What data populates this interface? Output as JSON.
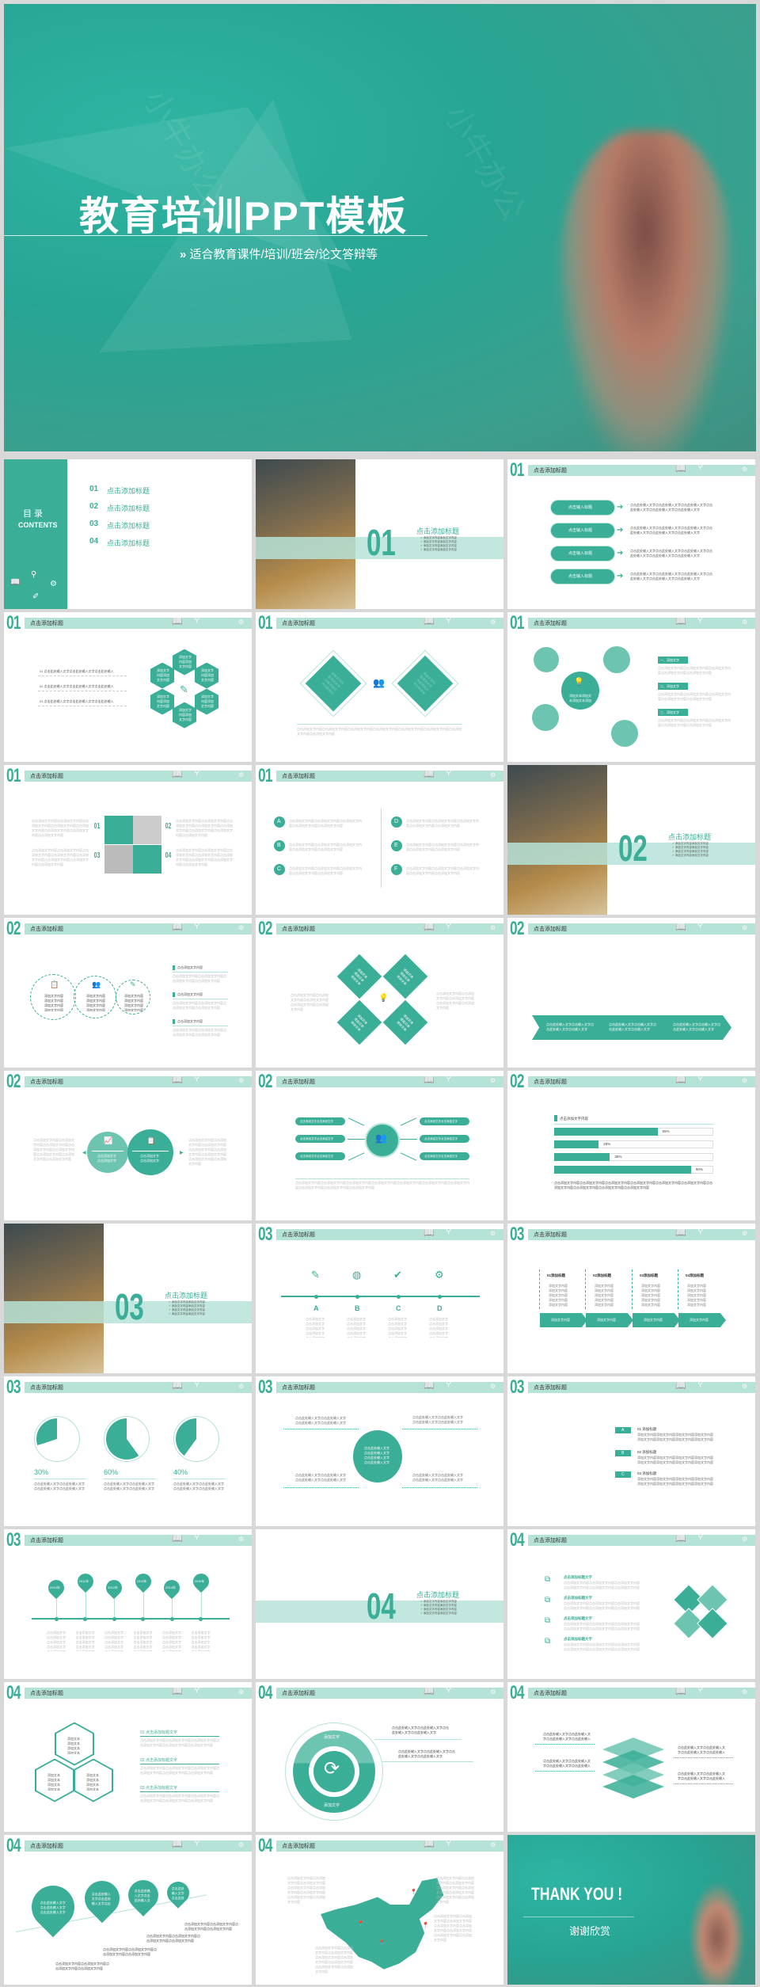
{
  "colors": {
    "accent": "#3aae97",
    "accent_light": "#b6e3d8",
    "accent_mid": "#6cc4b1",
    "bg": "#d8d8d8"
  },
  "cover": {
    "title": "教育培训PPT模板",
    "subtitle_icon": "double-chevron-right-icon",
    "subtitle_prefix": "»",
    "subtitle": "适合教育课件/培训/班会/论文答辩等",
    "watermark": "小牛办公"
  },
  "slides": [
    {
      "type": "toc",
      "heading": "目 录",
      "heading_en": "CONTENTS",
      "items": [
        {
          "num": "01",
          "label": "点击添加标题"
        },
        {
          "num": "02",
          "label": "点击添加标题"
        },
        {
          "num": "03",
          "label": "点击添加标题"
        },
        {
          "num": "04",
          "label": "点击添加标题"
        }
      ]
    },
    {
      "type": "section",
      "num": "01",
      "title": "点击添加标题",
      "photo": "chalk-tray-photo",
      "bullets": [
        "✓ 添加文字内容添加文字内容",
        "✓ 添加文字内容添加文字内容",
        "✓ 添加文字内容添加文字内容",
        "✓ 添加文字内容添加文字内容"
      ]
    },
    {
      "type": "arrows",
      "num": "01",
      "title": "点击添加标题",
      "items": [
        {
          "label": "点击输入标题",
          "text": "点击此处输入文字点击此处输入文字点击此处输入文字点击此处输入文字点击此处输入文字点击此处输入文字"
        },
        {
          "label": "点击输入标题",
          "text": "点击此处输入文字点击此处输入文字点击此处输入文字点击此处输入文字点击此处输入文字点击此处输入文字"
        },
        {
          "label": "点击输入标题",
          "text": "点击此处输入文字点击此处输入文字点击此处输入文字点击此处输入文字点击此处输入文字点击此处输入文字"
        },
        {
          "label": "点击输入标题",
          "text": "点击此处输入文字点击此处输入文字点击此处输入文字点击此处输入文字点击此处输入文字点击此处输入文字"
        }
      ]
    },
    {
      "type": "hex",
      "num": "01",
      "title": "点击添加标题",
      "lines": [
        "01 点击此处输入文字点击此处输入文字点击此处输入",
        "02 点击此处输入文字点击此处输入文字点击此处输入",
        "03 点击此处输入文字点击此处输入文字点击此处输入"
      ],
      "hex_text": "添加文字内容添加文字内容添加文字内容添加文字内容添加文字内容"
    },
    {
      "type": "diamonds",
      "num": "01",
      "title": "点击添加标题",
      "inner": "添加文字内容添加文字内容添加文字内容添加文字内容添加文字内容添加文字内容添加文字内容添加文字内容",
      "text": "点击添加文字内容点击添加文字内容点击添加文字内容点击添加文字内容点击添加文字内容点击添加文字内容点击添加文字内容点击添加文字内容"
    },
    {
      "type": "circles",
      "num": "01",
      "title": "点击添加标题",
      "center": "添加文本添加文本添加文本添加文本",
      "labels": [
        "一、添加文字",
        "二、添加文字",
        "三、添加文字"
      ],
      "text": "点击添加文字内容点击添加文字内容点击添加文字内容点击添加文字内容点击添加文字内容"
    },
    {
      "type": "grid",
      "num": "01",
      "title": "点击添加标题",
      "nums": [
        "01",
        "02",
        "03",
        "04"
      ],
      "text": "点击添加文字内容点击添加文字内容点击添加文字内容点击添加文字内容点击添加文字内容点击添加文字内容点击添加文字内容点击添加文字内容"
    },
    {
      "type": "abc",
      "num": "01",
      "title": "点击添加标题",
      "letters": [
        "A",
        "B",
        "C",
        "D",
        "E",
        "F"
      ],
      "text": "点击添加文字内容点击添加文字内容点击添加文字内容点击添加文字内容点击添加文字内容"
    },
    {
      "type": "section",
      "num": "02",
      "title": "点击添加标题",
      "photo": "presenter-pointer-photo",
      "bullets": [
        "✓ 添加文字内容添加文字内容",
        "✓ 添加文字内容添加文字内容",
        "✓ 添加文字内容添加文字内容",
        "✓ 添加文字内容添加文字内容"
      ]
    },
    {
      "type": "threecircles",
      "num": "02",
      "title": "点击添加标题",
      "circle_text": "添加文字内容添加文字内容添加文字内容添加文字内容",
      "labels": [
        "点击添加文字内容",
        "点击添加文字内容",
        "点击添加文字内容"
      ],
      "text": "点击添加文字内容点击添加文字内容点击添加文字内容点击添加文字内容"
    },
    {
      "type": "fourdiamonds",
      "num": "02",
      "title": "点击添加标题",
      "inner": "添加文本添加文本添加文本添加文本",
      "text": "点击添加文字内容点击添加文字内容点击添加文字内容点击添加文字内容点击添加文字内容"
    },
    {
      "type": "chevrons",
      "num": "02",
      "title": "点击添加标题",
      "text": "点击此处输入文字点击输入文字点击此处输入文字点击输入文字"
    },
    {
      "type": "twocircles",
      "num": "02",
      "title": "点击添加标题",
      "inner": "点击添加文字点击添加文字",
      "text": "点击添加文字内容点击添加文字内容点击添加文字内容点击添加文字内容点击添加文字内容点击添加文字内容点击添加文字内容点击添加文字内容"
    },
    {
      "type": "hub",
      "num": "02",
      "title": "点击添加标题",
      "pill": "点击添加文字点击添加文字",
      "text": "点击添加文字内容点击添加文字内容点击添加文字内容点击添加文字内容点击添加文字内容点击添加文字内容点击添加文字内容点击添加文字内容点击添加文字内容点击添加文字内容"
    },
    {
      "type": "bars",
      "num": "02",
      "title": "点击添加标题",
      "label": "点击添加文字内容",
      "values": [
        65,
        28,
        35,
        86
      ],
      "value_labels": [
        "65%",
        "28%",
        "35%",
        "86%"
      ],
      "text": "点击添加文字内容点击添加文字内容点击添加文字内容点击添加文字内容点击添加文字内容点击添加文字内容点击添加文字内容点击添加文字内容点击添加文字内容点击添加文字内容"
    },
    {
      "type": "section",
      "num": "03",
      "title": "点击添加标题",
      "photo": "chalk-pieces-photo",
      "bullets": [
        "✓ 添加文字内容添加文字内容",
        "✓ 添加文字内容添加文字内容",
        "✓ 添加文字内容添加文字内容",
        "✓ 添加文字内容添加文字内容"
      ]
    },
    {
      "type": "iconline",
      "num": "03",
      "title": "点击添加标题",
      "icons": [
        "pencil-icon",
        "globe-icon",
        "checkmark-icon",
        "gear-icon"
      ],
      "glyphs": [
        "✎",
        "◍",
        "✔",
        "⚙"
      ],
      "letters": [
        "A",
        "B",
        "C",
        "D"
      ],
      "text": "点击添加文字点击添加文字点击添加文字点击添加文字点击添加文字"
    },
    {
      "type": "columns",
      "num": "03",
      "title": "点击添加标题",
      "heads": [
        "01添加标题",
        "02添加标题",
        "03添加标题",
        "04添加标题"
      ],
      "chev": "添加文字内容",
      "text": "添加文字内容添加文字内容添加文字内容添加文字内容添加文字内容添加文字内容"
    },
    {
      "type": "pies",
      "num": "03",
      "title": "点击添加标题",
      "values": [
        30,
        60,
        40
      ],
      "value_labels": [
        "30%",
        "60%",
        "40%"
      ],
      "text": "点击此处输入文字点击此处输入文字点击此处输入文字点击此处输入文字"
    },
    {
      "type": "center",
      "num": "03",
      "title": "点击添加标题",
      "center": "点击此处输入文字点击此处输入文字点击此处输入文字点击此处输入文字",
      "text": "点击此处输入文字点击此处输入文字点击此处输入文字点击此处输入文字"
    },
    {
      "type": "list",
      "num": "03",
      "title": "点击添加标题",
      "letters": [
        "A",
        "B",
        "C"
      ],
      "heads": [
        "01 添加标题",
        "02 添加标题",
        "03 添加标题"
      ],
      "text": "添加文字内容添加文字内容添加文字内容添加文字内容添加文字内容添加文字内容添加文字内容添加文字内容"
    },
    {
      "type": "years",
      "num": "03",
      "title": "点击添加标题",
      "years": [
        "2010年",
        "2011年",
        "2012年",
        "2013年",
        "2014年",
        "2015年"
      ],
      "text": "点击添加文字点击添加文字点击添加文字点击添加文字点击添加文字"
    },
    {
      "type": "section",
      "num": "04",
      "title": "点击添加标题",
      "photo": "",
      "bullets": [
        "✓ 添加文字内容添加文字内容",
        "✓ 添加文字内容添加文字内容",
        "✓ 添加文字内容添加文字内容",
        "✓ 添加文字内容添加文字内容"
      ]
    },
    {
      "type": "puzzle",
      "num": "04",
      "title": "点击添加标题",
      "heads": [
        "点击添加标题文字",
        "点击添加标题文字",
        "点击添加标题文字",
        "点击添加标题文字"
      ],
      "text": "点击添加文字内容点击添加文字内容点击添加文字内容点击添加文字内容点击添加文字内容点击添加文字内容"
    },
    {
      "type": "hexes",
      "num": "04",
      "title": "点击添加标题",
      "heads": [
        "01 点击添加标题文字",
        "02 点击添加标题文字",
        "03 点击添加标题文字"
      ],
      "inner": "添加文本添加文本添加文本添加文本",
      "text": "点击添加文字内容点击添加文字内容点击添加文字内容点击添加文字内容点击添加文字内容点击添加文字内容"
    },
    {
      "type": "ring",
      "num": "04",
      "title": "点击添加标题",
      "labels": [
        "添加文字",
        "添加文字"
      ],
      "text": "点击此处输入文字点击此处输入文字点击此处输入文字点击此处输入文字"
    },
    {
      "type": "layers",
      "num": "04",
      "title": "点击添加标题",
      "text": "点击此处输入文字点击此处输入文字点击此处输入文字点击此处输入文字"
    },
    {
      "type": "pins",
      "num": "04",
      "title": "点击添加标题",
      "inner": "点击此处输入文字点击此处输入文字点击此处输入文字",
      "text": "点击添加文字内容点击添加文字内容点击添加文字内容点击添加文字内容"
    },
    {
      "type": "map",
      "num": "04",
      "title": "点击添加标题",
      "text": "点击添加文字内容点击添加文字内容点击添加文字内容点击添加文字内容点击添加文字内容点击添加文字内容点击添加文字内容点击添加文字内容"
    },
    {
      "type": "thanks",
      "title": "THANK YOU !",
      "subtitle": "谢谢欣赏"
    }
  ]
}
